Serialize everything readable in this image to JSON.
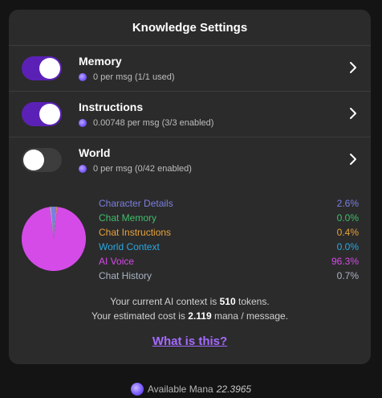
{
  "panel": {
    "title": "Knowledge Settings"
  },
  "rows": [
    {
      "title": "Memory",
      "subtitle": "0 per msg (1/1 used)",
      "enabled": true
    },
    {
      "title": "Instructions",
      "subtitle": "0.00748 per msg (3/3 enabled)",
      "enabled": true
    },
    {
      "title": "World",
      "subtitle": "0 per msg (0/42 enabled)",
      "enabled": false
    }
  ],
  "chart_data": {
    "type": "pie",
    "slices": [
      {
        "label": "Character Details",
        "value": 2.6,
        "display": "2.6%",
        "color": "#7b7fe0"
      },
      {
        "label": "Chat Memory",
        "value": 0.0,
        "display": "0.0%",
        "color": "#3fbf6a"
      },
      {
        "label": "Chat Instructions",
        "value": 0.4,
        "display": "0.4%",
        "color": "#e8a23a"
      },
      {
        "label": "World Context",
        "value": 0.0,
        "display": "0.0%",
        "color": "#2aa8e0"
      },
      {
        "label": "AI Voice",
        "value": 96.3,
        "display": "96.3%",
        "color": "#d54be8"
      },
      {
        "label": "Chat History",
        "value": 0.7,
        "display": "0.7%",
        "color": "#a9b3c2"
      }
    ]
  },
  "info": {
    "line1_prefix": "Your current AI context is",
    "tokens": "510",
    "line1_suffix": "tokens.",
    "line2_prefix": "Your estimated cost is",
    "cost": "2.119",
    "line2_suffix": "mana / message."
  },
  "link": {
    "label": "What is this?"
  },
  "footer": {
    "label": "Available Mana",
    "value": "22.3965"
  },
  "colors": {
    "toggle_on": "#5b21b6",
    "link": "#a56bff",
    "panel_bg": "#2b2b2b"
  },
  "icons": {
    "mana": "mana-orb-icon",
    "chevron": "chevron-right-icon"
  }
}
